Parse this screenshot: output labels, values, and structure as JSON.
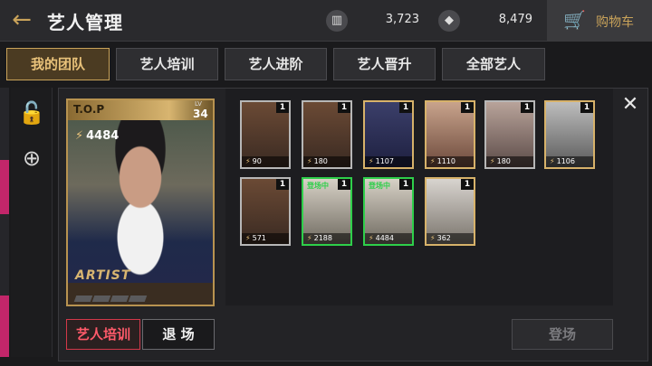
{
  "header": {
    "title": "艺人管理",
    "back_icon": "←",
    "currency1": {
      "icon": "album-icon",
      "glyph": "▥",
      "value": "3,723"
    },
    "currency2": {
      "icon": "diamond-icon",
      "glyph": "◆",
      "value": "8,479"
    },
    "cart": {
      "label": "购物车",
      "glyph": "🛒"
    }
  },
  "tabs": [
    {
      "label": "我的团队",
      "active": true
    },
    {
      "label": "艺人培训",
      "active": false
    },
    {
      "label": "艺人进阶",
      "active": false
    },
    {
      "label": "艺人晋升",
      "active": false
    },
    {
      "label": "全部艺人",
      "active": false
    }
  ],
  "side": {
    "lock_glyph": "🔓",
    "zoom_glyph": "⊕"
  },
  "selected_card": {
    "name": "T.O.P",
    "lv_tag": "LV",
    "level": "34",
    "power": "4484",
    "logo": "ARTIST",
    "bolt": "⚡"
  },
  "buttons": {
    "train": "艺人培训",
    "leave": "退 场",
    "debut": "登场",
    "close": "✕"
  },
  "cards": [
    {
      "level": "1",
      "power": "90",
      "tag": "",
      "style": "plain"
    },
    {
      "level": "1",
      "power": "180",
      "tag": "",
      "style": "plain"
    },
    {
      "level": "1",
      "power": "1107",
      "tag": "",
      "style": "gold"
    },
    {
      "level": "1",
      "power": "1110",
      "tag": "",
      "style": "gold"
    },
    {
      "level": "1",
      "power": "180",
      "tag": "",
      "style": "plain"
    },
    {
      "level": "1",
      "power": "1106",
      "tag": "",
      "style": "gold"
    },
    {
      "level": "1",
      "power": "571",
      "tag": "",
      "style": "plain"
    },
    {
      "level": "1",
      "power": "2188",
      "tag": "登场中",
      "style": "sel"
    },
    {
      "level": "1",
      "power": "4484",
      "tag": "登场中",
      "style": "sel"
    },
    {
      "level": "1",
      "power": "362",
      "tag": "",
      "style": "gold"
    }
  ],
  "colors": {
    "accent": "#c9a35a",
    "selected": "#2ecf4a",
    "danger": "#ff5a6a"
  }
}
